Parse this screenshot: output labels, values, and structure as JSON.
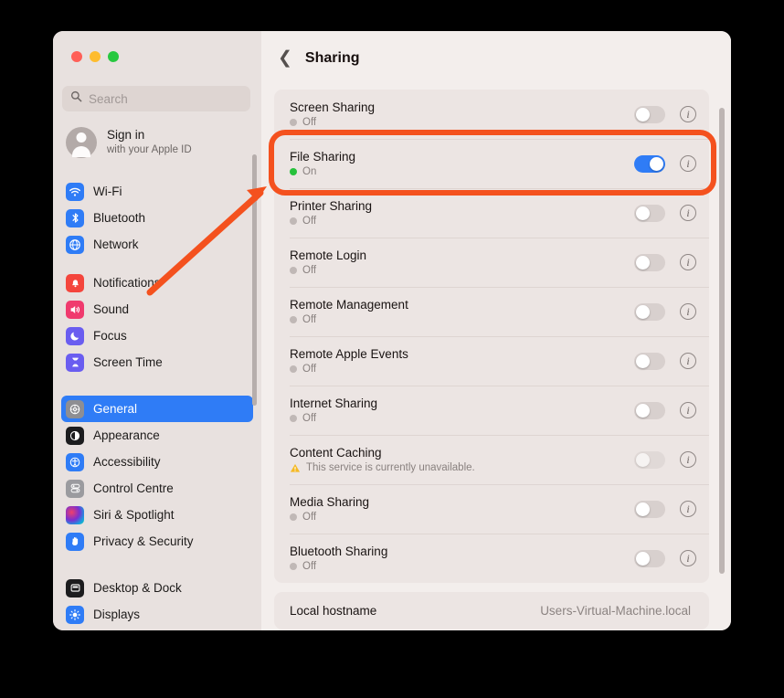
{
  "window": {
    "traffic_lights": [
      {
        "name": "close",
        "color": "#ff5f57"
      },
      {
        "name": "minimize",
        "color": "#febc2e"
      },
      {
        "name": "zoom",
        "color": "#28c840"
      }
    ]
  },
  "sidebar": {
    "search": {
      "placeholder": "Search",
      "value": "",
      "icon": "search-icon"
    },
    "account": {
      "name": "Sign in",
      "subtitle": "with your Apple ID",
      "avatar": "person-avatar-icon"
    },
    "groups": [
      {
        "items": [
          {
            "label": "Wi-Fi",
            "icon": "wifi-icon",
            "color": "#2f7cf6",
            "selected": false
          },
          {
            "label": "Bluetooth",
            "icon": "bluetooth-icon",
            "color": "#2f7cf6",
            "selected": false
          },
          {
            "label": "Network",
            "icon": "globe-icon",
            "color": "#2f7cf6",
            "selected": false
          }
        ]
      },
      {
        "items": [
          {
            "label": "Notifications",
            "icon": "bell-icon",
            "color": "#f4453c",
            "selected": false
          },
          {
            "label": "Sound",
            "icon": "speaker-icon",
            "color": "#f03a6e",
            "selected": false
          },
          {
            "label": "Focus",
            "icon": "moon-icon",
            "color": "#6a5df0",
            "selected": false
          },
          {
            "label": "Screen Time",
            "icon": "hourglass-icon",
            "color": "#6a5df0",
            "selected": false
          }
        ]
      },
      {
        "items": [
          {
            "label": "General",
            "icon": "gear-icon",
            "color": "#8e8e93",
            "selected": true
          },
          {
            "label": "Appearance",
            "icon": "contrast-circle-icon",
            "color": "#1c1c1e",
            "selected": false
          },
          {
            "label": "Accessibility",
            "icon": "accessibility-icon",
            "color": "#2f7cf6",
            "selected": false
          },
          {
            "label": "Control Centre",
            "icon": "control-centre-icon",
            "color": "#9b9b9f",
            "selected": false
          },
          {
            "label": "Siri & Spotlight",
            "icon": "siri-icon",
            "color": "#5d2f8e",
            "selected": false
          },
          {
            "label": "Privacy & Security",
            "icon": "hand-raised-icon",
            "color": "#2f7cf6",
            "selected": false
          }
        ]
      },
      {
        "items": [
          {
            "label": "Desktop & Dock",
            "icon": "desktop-dock-icon",
            "color": "#1c1c1e",
            "selected": false
          },
          {
            "label": "Displays",
            "icon": "brightness-icon",
            "color": "#2f7cf6",
            "selected": false
          }
        ]
      }
    ]
  },
  "main": {
    "back_icon": "chevron-left-icon",
    "title": "Sharing",
    "services": [
      {
        "name": "Screen Sharing",
        "status": "Off",
        "state": "off",
        "toggle": "off",
        "toggle_dim": false,
        "info": "i"
      },
      {
        "name": "File Sharing",
        "status": "On",
        "state": "on",
        "toggle": "on",
        "toggle_dim": false,
        "info": "i"
      },
      {
        "name": "Printer Sharing",
        "status": "Off",
        "state": "off",
        "toggle": "off",
        "toggle_dim": false,
        "info": "i"
      },
      {
        "name": "Remote Login",
        "status": "Off",
        "state": "off",
        "toggle": "off",
        "toggle_dim": false,
        "info": "i"
      },
      {
        "name": "Remote Management",
        "status": "Off",
        "state": "off",
        "toggle": "off",
        "toggle_dim": false,
        "info": "i"
      },
      {
        "name": "Remote Apple Events",
        "status": "Off",
        "state": "off",
        "toggle": "off",
        "toggle_dim": false,
        "info": "i"
      },
      {
        "name": "Internet Sharing",
        "status": "Off",
        "state": "off",
        "toggle": "off",
        "toggle_dim": false,
        "info": "i"
      },
      {
        "name": "Content Caching",
        "status": "This service is currently unavailable.",
        "state": "warning",
        "toggle": "off",
        "toggle_dim": true,
        "info": "i"
      },
      {
        "name": "Media Sharing",
        "status": "Off",
        "state": "off",
        "toggle": "off",
        "toggle_dim": false,
        "info": "i"
      },
      {
        "name": "Bluetooth Sharing",
        "status": "Off",
        "state": "off",
        "toggle": "off",
        "toggle_dim": false,
        "info": "i"
      }
    ],
    "hostname": {
      "label": "Local hostname",
      "value": "Users-Virtual-Machine.local"
    }
  },
  "annotation": {
    "color": "#f4511e",
    "highlight_target": "File Sharing",
    "shapes": [
      "rounded-rectangle-highlight",
      "arrow-pointer"
    ]
  },
  "colors": {
    "accent_blue": "#2f7cf6",
    "status_on_green": "#27c23c",
    "warning_yellow": "#f5b923",
    "annotation_red": "#f4511e"
  }
}
